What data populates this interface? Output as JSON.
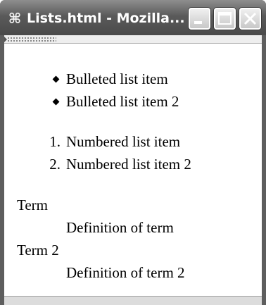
{
  "window": {
    "title": "Lists.html - Mozilla...",
    "app_icon": "mozilla-app-icon",
    "controls": {
      "minimize_icon": "minimize-icon",
      "maximize_icon": "maximize-icon",
      "close_icon": "close-icon"
    }
  },
  "content": {
    "bulleted_list": [
      "Bulleted list item",
      "Bulleted list item 2"
    ],
    "numbered_list": {
      "numbers": [
        "1.",
        "2."
      ],
      "items": [
        "Numbered list item",
        "Numbered list item 2"
      ]
    },
    "definition_list": [
      {
        "term": "Term",
        "definition": "Definition of term"
      },
      {
        "term": "Term 2",
        "definition": "Definition of term 2"
      }
    ]
  }
}
